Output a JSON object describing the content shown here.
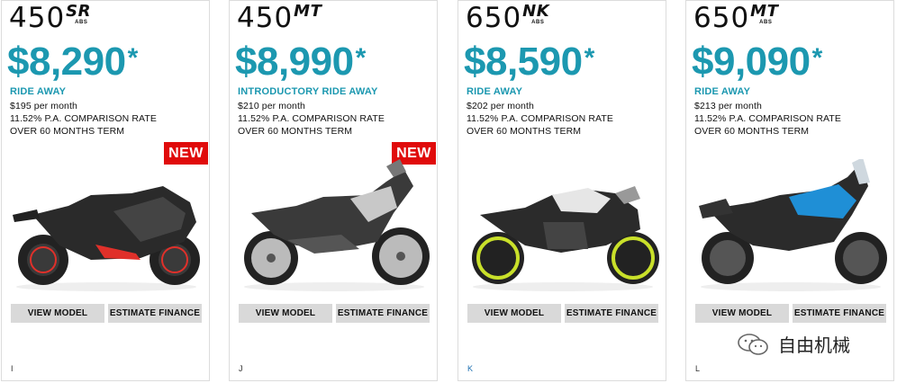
{
  "cards": [
    {
      "model_num": "450",
      "model_suffix": "SR",
      "model_abs": "ABS",
      "price": "$8,290",
      "price_mark": "*",
      "offer": "RIDE AWAY",
      "per_month": "$195 per month",
      "rate": "11.52% P.A. COMPARISON RATE",
      "term": "OVER 60 MONTHS TERM",
      "badge": "NEW",
      "view_label": "VIEW MODEL",
      "finance_label": "ESTIMATE FINANCE",
      "letter": "I",
      "body_color": "#2a2a2a",
      "accent": "#e0302a",
      "wheel_color": "#e0302a"
    },
    {
      "model_num": "450",
      "model_suffix": "MT",
      "model_abs": "",
      "price": "$8,990",
      "price_mark": "*",
      "offer": "INTRODUCTORY RIDE AWAY",
      "per_month": "$210 per month",
      "rate": "11.52% P.A. COMPARISON RATE",
      "term": "OVER 60 MONTHS TERM",
      "badge": "NEW",
      "view_label": "VIEW MODEL",
      "finance_label": "ESTIMATE FINANCE",
      "letter": "J",
      "body_color": "#3a3a3a",
      "accent": "#c8c8c8",
      "wheel_color": "#9a9a9a"
    },
    {
      "model_num": "650",
      "model_suffix": "NK",
      "model_abs": "ABS",
      "price": "$8,590",
      "price_mark": "*",
      "offer": "RIDE AWAY",
      "per_month": "$202 per month",
      "rate": "11.52% P.A. COMPARISON RATE",
      "term": "OVER 60 MONTHS TERM",
      "badge": "",
      "view_label": "VIEW MODEL",
      "finance_label": "ESTIMATE FINANCE",
      "letter": "K",
      "body_color": "#2b2b2b",
      "accent": "#e6e6e6",
      "wheel_color": "#c9e02a"
    },
    {
      "model_num": "650",
      "model_suffix": "MT",
      "model_abs": "ABS",
      "price": "$9,090",
      "price_mark": "*",
      "offer": "RIDE AWAY",
      "per_month": "$213 per month",
      "rate": "11.52% P.A. COMPARISON RATE",
      "term": "OVER 60 MONTHS TERM",
      "badge": "",
      "view_label": "VIEW MODEL",
      "finance_label": "ESTIMATE FINANCE",
      "letter": "L",
      "body_color": "#2b2b2b",
      "accent": "#1f8fd6",
      "wheel_color": "#555555"
    }
  ],
  "watermark": {
    "text": "自由机械",
    "icon": "wechat-icon"
  }
}
